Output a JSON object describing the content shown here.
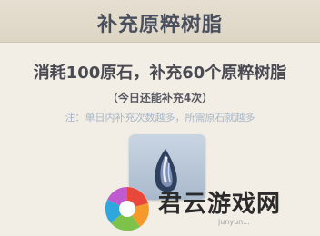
{
  "dialog": {
    "title": "补充原粹树脂",
    "main_line": "消耗100原石，补充60个原粹树脂",
    "remaining_line": "（今日还能补充4次）",
    "note_line": "注：单日内补充次数越多，所需原石就越多",
    "item_icon": "fragile-resin-icon"
  },
  "watermark": {
    "text": "君云游戏网",
    "subtext": "junyun..."
  },
  "colors": {
    "title": "#4a4f5e",
    "note": "#a8b7c8",
    "card": "#b7c5d6"
  }
}
